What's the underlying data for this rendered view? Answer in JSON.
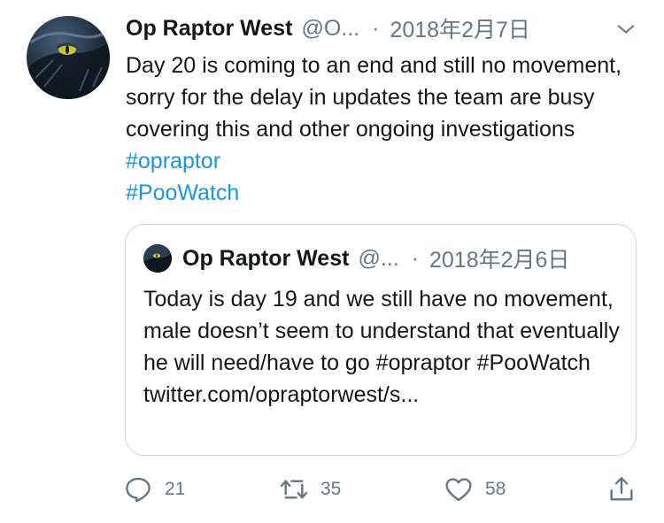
{
  "tweet": {
    "author_name": "Op Raptor West",
    "author_handle": "@O...",
    "separator": "·",
    "date": "2018年2月7日",
    "text_plain": "Day 20 is coming to an end and still no movement, sorry for the delay in updates the team are busy covering this and other ongoing investigations",
    "hashtag_1": "#opraptor",
    "hashtag_2": "#PooWatch"
  },
  "quoted_tweet": {
    "author_name": "Op Raptor West",
    "author_handle": "@...",
    "separator": "·",
    "date": "2018年2月6日",
    "text": "Today is day 19 and we still have no movement, male doesn’t seem to understand that eventually he will need/have to go #opraptor #PooWatch twitter.com/opraptorwest/s..."
  },
  "actions": {
    "reply_count": "21",
    "retweet_count": "35",
    "like_count": "58"
  },
  "icons": {
    "reply": "reply-icon",
    "retweet": "retweet-icon",
    "like": "heart-icon",
    "share": "share-icon",
    "menu": "chevron-down-icon"
  },
  "colors": {
    "text": "#14171a",
    "muted": "#657786",
    "link": "#1b95e0",
    "border": "#ccd6dd"
  }
}
